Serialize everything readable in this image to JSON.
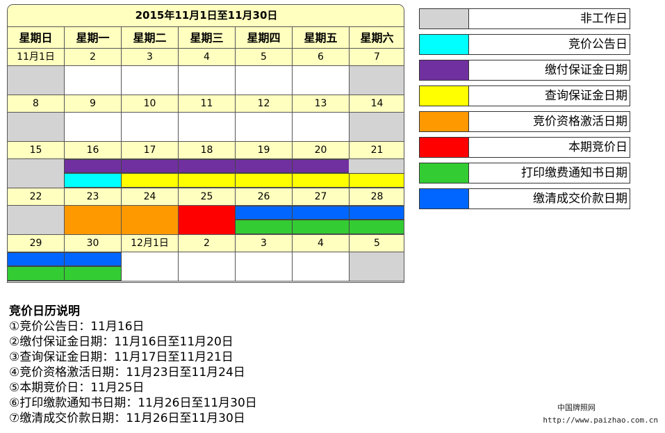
{
  "calendar": {
    "title": "2015年11月1日至11月30日",
    "weekdays": [
      "星期日",
      "星期一",
      "星期二",
      "星期三",
      "星期四",
      "星期五",
      "星期六"
    ],
    "weeks": [
      {
        "dates": [
          "11月1日",
          "2",
          "3",
          "4",
          "5",
          "6",
          "7"
        ],
        "fills": [
          [
            "gray"
          ],
          [
            "white"
          ],
          [
            "white"
          ],
          [
            "white"
          ],
          [
            "white"
          ],
          [
            "white"
          ],
          [
            "gray"
          ]
        ]
      },
      {
        "dates": [
          "8",
          "9",
          "10",
          "11",
          "12",
          "13",
          "14"
        ],
        "fills": [
          [
            "gray"
          ],
          [
            "white"
          ],
          [
            "white"
          ],
          [
            "white"
          ],
          [
            "white"
          ],
          [
            "white"
          ],
          [
            "gray"
          ]
        ]
      },
      {
        "dates": [
          "15",
          "16",
          "17",
          "18",
          "19",
          "20",
          "21"
        ],
        "fills": [
          [
            "gray"
          ],
          [
            "purple",
            "cyan"
          ],
          [
            "purple",
            "yellow"
          ],
          [
            "purple",
            "yellow"
          ],
          [
            "purple",
            "yellow"
          ],
          [
            "purple",
            "yellow"
          ],
          [
            "gray",
            "yellow"
          ]
        ]
      },
      {
        "dates": [
          "22",
          "23",
          "24",
          "25",
          "26",
          "27",
          "28"
        ],
        "fills": [
          [
            "gray"
          ],
          [
            "orange"
          ],
          [
            "orange"
          ],
          [
            "red"
          ],
          [
            "blue",
            "green"
          ],
          [
            "blue",
            "green"
          ],
          [
            "blue",
            "green"
          ]
        ]
      },
      {
        "dates": [
          "29",
          "30",
          "12月1日",
          "2",
          "3",
          "4",
          "5"
        ],
        "fills": [
          [
            "blue",
            "green"
          ],
          [
            "blue",
            "green"
          ],
          [
            "white"
          ],
          [
            "white"
          ],
          [
            "white"
          ],
          [
            "white"
          ],
          [
            "gray"
          ]
        ]
      }
    ]
  },
  "colors": {
    "gray": "#d3d3d3",
    "white": "#ffffff",
    "cyan": "#00ffff",
    "purple": "#7030a0",
    "yellow": "#ffff00",
    "orange": "#ff9900",
    "red": "#ff0000",
    "green": "#33cc33",
    "blue": "#0066ff"
  },
  "legend": [
    {
      "color": "gray",
      "label": "非工作日"
    },
    {
      "color": "cyan",
      "label": "竞价公告日"
    },
    {
      "color": "purple",
      "label": "缴付保证金日期"
    },
    {
      "color": "yellow",
      "label": "查询保证金日期"
    },
    {
      "color": "orange",
      "label": "竞价资格激活日期"
    },
    {
      "color": "red",
      "label": "本期竞价日"
    },
    {
      "color": "green",
      "label": "打印缴费通知书日期"
    },
    {
      "color": "blue",
      "label": "缴清成交价款日期"
    }
  ],
  "notes": {
    "title": "竞价日历说明",
    "lines": [
      "①竞价公告日：11月16日",
      "②缴付保证金日期：11月16日至11月20日",
      "③查询保证金日期：11月17日至11月21日",
      "④竞价资格激活日期：11月23日至11月24日",
      "⑤本期竞价日：11月25日",
      "⑥打印缴款通知书日期：11月26日至11月30日",
      "⑦缴清成交价款日期：11月26日至11月30日"
    ]
  },
  "watermark": {
    "name": "中国牌照网",
    "url": "http://www.paizhao.com.cn"
  }
}
